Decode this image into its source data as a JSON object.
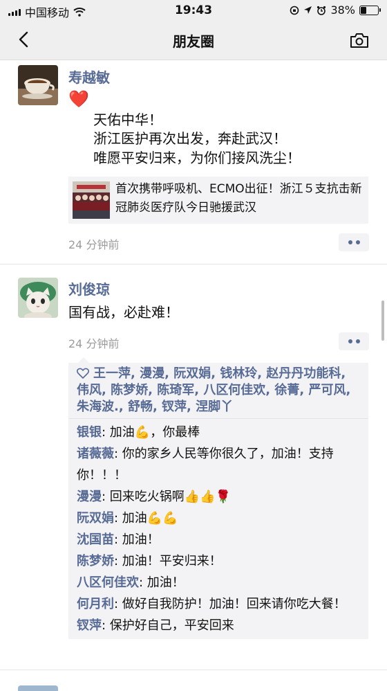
{
  "status_bar": {
    "carrier": "中国移动",
    "time": "19:43",
    "battery": "38%",
    "battery_level": 0.38
  },
  "nav": {
    "title": "朋友圈",
    "back_icon": "chevron-left-icon",
    "camera_icon": "camera-icon"
  },
  "posts": [
    {
      "author": "寿越敏",
      "emoji": "❤️",
      "lines": [
        "天佑中华！",
        "浙江医护再次出发，奔赴武汉！",
        "唯愿平安归来，为你们接风洗尘！"
      ],
      "link_card": {
        "title": "首次携带呼吸机、ECMO出征！浙江５支抗击新冠肺炎医疗队今日驰援武汉"
      },
      "time_ago": "24 分钟前"
    },
    {
      "author": "刘俊琼",
      "text": "国有战，必赴难！",
      "time_ago": "24 分钟前",
      "likes_text": "王一萍, 漫漫, 阮双娟, 钱林玲, 赵丹丹功能科, 伟风, 陈梦娇, 陈琦军, 八区何佳欢, 徐菁, 严可风, 朱海波., 舒畅, 钗萍, 涅脚丫",
      "comments": [
        {
          "name": "银银",
          "text": ": 加油💪，你最棒"
        },
        {
          "name": "诸薇薇",
          "text": ": 你的家乡人民等你很久了，加油！支持你！！！"
        },
        {
          "name": "漫漫",
          "text": ": 回来吃火锅啊👍👍🌹"
        },
        {
          "name": "阮双娟",
          "text": ": 加油💪💪"
        },
        {
          "name": "沈国苗",
          "text": ": 加油！"
        },
        {
          "name": "陈梦娇",
          "text": ": 加油！平安归来！"
        },
        {
          "name": "八区何佳欢",
          "text": ": 加油！"
        },
        {
          "name": "何月利",
          "text": ": 做好自我防护！加油！回来请你吃大餐！"
        },
        {
          "name": "钗萍",
          "text": ": 保护好自己，平安回来"
        }
      ]
    }
  ],
  "colors": {
    "link": "#576b95",
    "bar": "#efefef",
    "panel": "#f3f3f5",
    "meta": "#9b9b9b"
  }
}
